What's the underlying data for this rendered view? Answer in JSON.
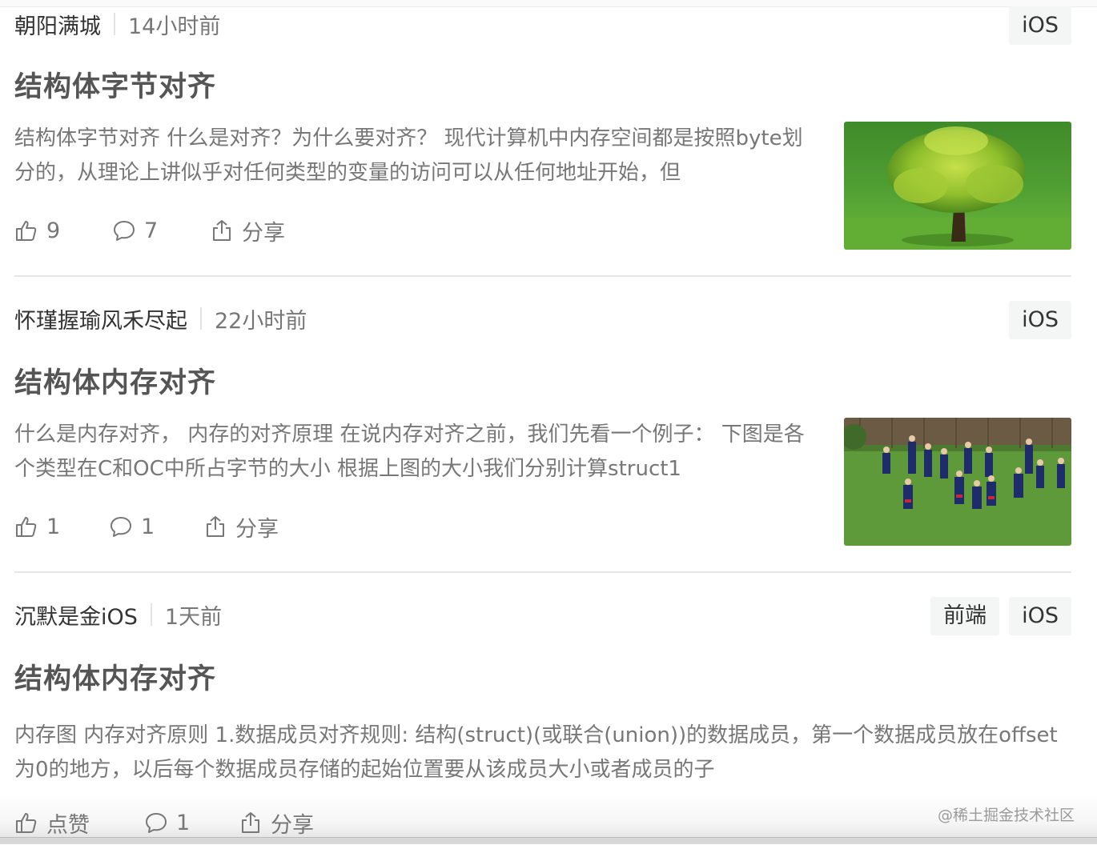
{
  "feed": {
    "items": [
      {
        "author": "朝阳满城",
        "time": "14小时前",
        "tags": [
          "iOS"
        ],
        "title": "结构体字节对齐",
        "abstract": "结构体字节对齐 什么是对齐？为什么要对齐？ 现代计算机中内存空间都是按照byte划分的，从理论上讲似乎对任何类型的变量的访问可以从任何地址开始，但",
        "likes": "9",
        "comments": "7",
        "share": "分享",
        "thumbnail": "tree-on-grass-photo"
      },
      {
        "author": "怀瑾握瑜风禾尽起",
        "time": "22小时前",
        "tags": [
          "iOS"
        ],
        "title": "结构体内存对齐",
        "abstract": "什么是内存对齐， 内存的对齐原理 在说内存对齐之前，我们先看一个例子： 下图是各个类型在C和OC中所占字节的大小 根据上图的大小我们分别计算struct1",
        "likes": "1",
        "comments": "1",
        "share": "分享",
        "thumbnail": "kids-playing-rugby-photo"
      },
      {
        "author": "沉默是金iOS",
        "time": "1天前",
        "tags": [
          "前端",
          "iOS"
        ],
        "title": "结构体内存对齐",
        "abstract": "内存图 内存对齐原则 1.数据成员对齐规则: 结构(struct)(或联合(union))的数据成员，第一个数据成员放在offset为0的地方，以后每个数据成员存储的起始位置要从该成员大小或者成员的子",
        "likes": "点赞",
        "comments": "1",
        "share": "分享"
      }
    ]
  },
  "watermark": "@稀土掘金技术社区",
  "colors": {
    "title": "#555555",
    "text": "#777777",
    "tag_bg": "#f4f5f5",
    "divider": "#e6e6e6"
  }
}
